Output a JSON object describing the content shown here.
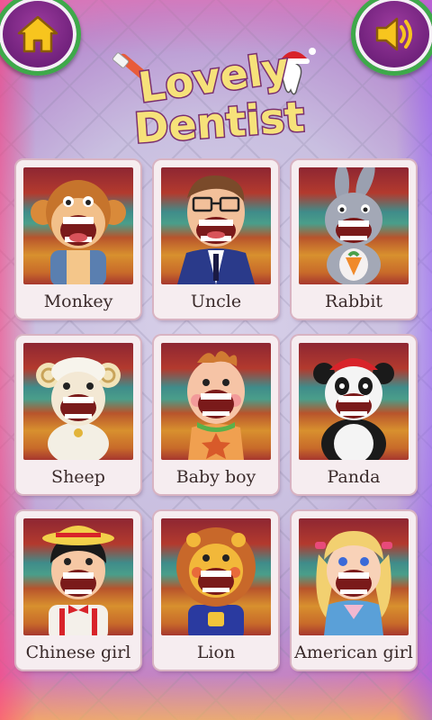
{
  "title": {
    "line1": "Lovely",
    "line2": "Dentist"
  },
  "buttons": {
    "home": "home-icon",
    "sound": "speaker-icon"
  },
  "characters": [
    {
      "name": "Monkey"
    },
    {
      "name": "Uncle"
    },
    {
      "name": "Rabbit"
    },
    {
      "name": "Sheep"
    },
    {
      "name": "Baby boy"
    },
    {
      "name": "Panda"
    },
    {
      "name": "Chinese girl"
    },
    {
      "name": "Lion"
    },
    {
      "name": "American girl"
    }
  ],
  "colors": {
    "title_fill": "#f6e27a",
    "title_stroke": "#7a2f6f",
    "button_ring": "#3ea94a",
    "button_fill": "#7a2a86"
  }
}
